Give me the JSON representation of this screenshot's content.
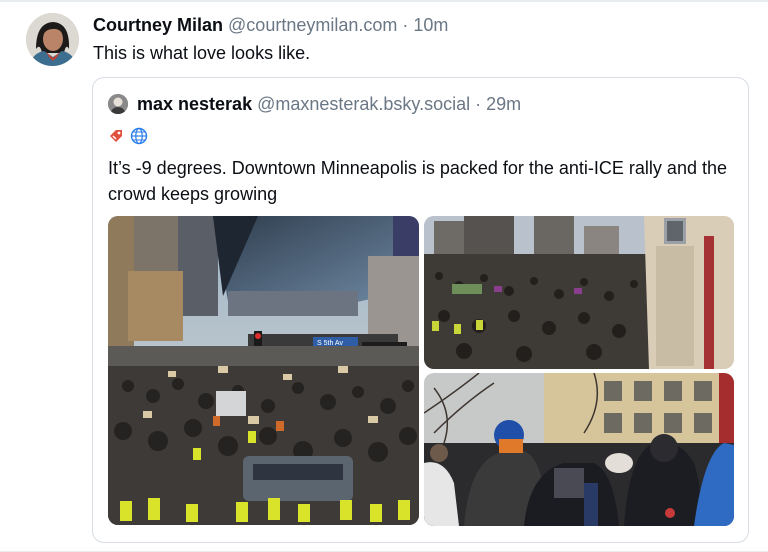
{
  "post": {
    "author": "Courtney Milan",
    "handle": "@courtneymilan.com",
    "separator": "·",
    "time": "10m",
    "text": "This is what love looks like."
  },
  "quote": {
    "author": "max nesterak",
    "handle": "@maxnesterak.bsky.social",
    "separator": "·",
    "time": "29m",
    "badges": [
      "tag-icon",
      "globe-icon"
    ],
    "text": "It’s -9 degrees. Downtown Minneapolis is packed for the anti-ICE rally and the crowd keeps growing",
    "images": [
      {
        "name": "downtown-crowd-photo",
        "street_sign": "S 5th Av"
      },
      {
        "name": "plaza-crowd-photo"
      },
      {
        "name": "protesters-closeup-photo"
      }
    ]
  }
}
